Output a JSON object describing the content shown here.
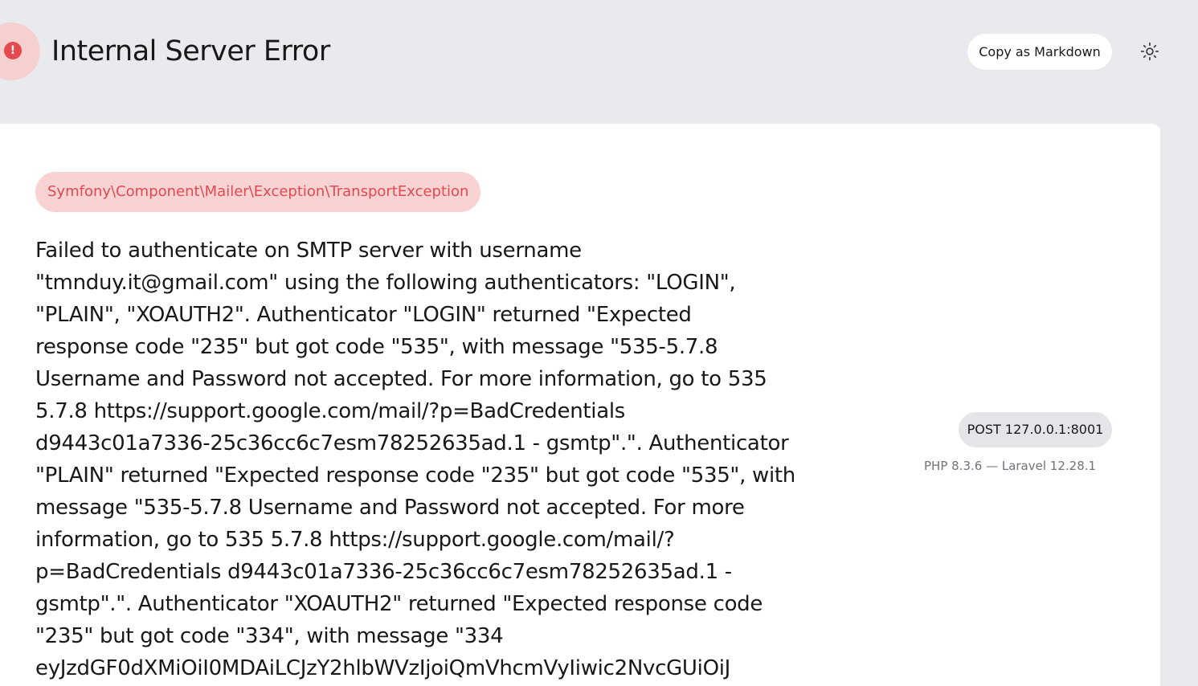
{
  "header": {
    "title": "Internal Server Error",
    "error_icon": "exclamation-circle-icon",
    "error_glyph": "!",
    "copy_button_label": "Copy as Markdown",
    "theme_icon": "sun-icon"
  },
  "exception": {
    "class": "Symfony\\Component\\Mailer\\Exception\\TransportException",
    "message_lines": [
      "Failed to authenticate on SMTP server with username",
      "\"tmnduy.it@gmail.com\" using the following authenticators: \"LOGIN\",",
      "\"PLAIN\", \"XOAUTH2\". Authenticator \"LOGIN\" returned \"Expected",
      "response code \"235\" but got code \"535\", with message \"535-5.7.8",
      "Username and Password not accepted. For more information, go to 535",
      "5.7.8 https://support.google.com/mail/?p=BadCredentials",
      "d9443c01a7336-25c36cc6c7esm78252635ad.1 - gsmtp\".\". Authenticator",
      "\"PLAIN\" returned \"Expected response code \"235\" but got code \"535\", with",
      "message \"535-5.7.8 Username and Password not accepted. For more",
      "information, go to 535 5.7.8 https://support.google.com/mail/?",
      "p=BadCredentials d9443c01a7336-25c36cc6c7esm78252635ad.1 -",
      "gsmtp\".\". Authenticator \"XOAUTH2\" returned \"Expected response code",
      "\"235\" but got code \"334\", with message \"334",
      "eyJzdGF0dXMiOiI0MDAiLCJzY2hlbWVzIjoiQmVhcmVyIiwic2NvcGUiOiJ"
    ]
  },
  "request": {
    "method_url": "POST 127.0.0.1:8001",
    "versions": "PHP 8.3.6 — Laravel 12.28.1"
  },
  "colors": {
    "background": "#e9eaed",
    "card": "#ffffff",
    "error_accent": "#e5484d",
    "error_soft": "#f9d3d4",
    "text": "#18181b",
    "muted": "#71717a"
  }
}
